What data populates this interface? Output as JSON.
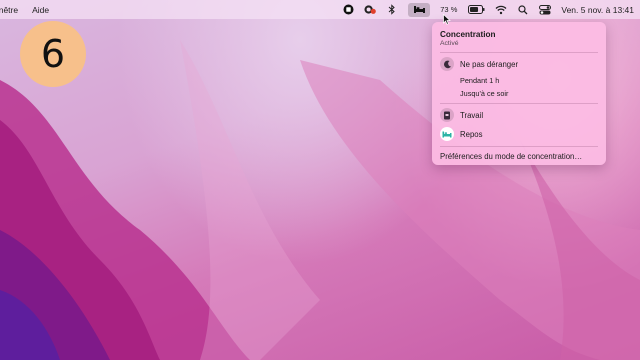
{
  "menubar": {
    "left_items": [
      "enêtre",
      "Aide"
    ],
    "battery_percent": "73 %",
    "clock": "Ven. 5 nov. à  13:41",
    "battery_level": 0.73,
    "icons": [
      "record-icon",
      "cloud-sync-icon",
      "bluetooth-icon",
      "focus-bed-icon",
      "battery-icon",
      "wifi-icon",
      "search-icon",
      "control-center-icon"
    ]
  },
  "step": {
    "number": "6"
  },
  "focus_menu": {
    "title": "Concentration",
    "subtitle": "Activé",
    "do_not_disturb": "Ne pas déranger",
    "option_1h": "Pendant 1 h",
    "option_evening": "Jusqu'à ce soir",
    "work": "Travail",
    "rest": "Repos",
    "preferences": "Préférences du mode de concentration…"
  }
}
